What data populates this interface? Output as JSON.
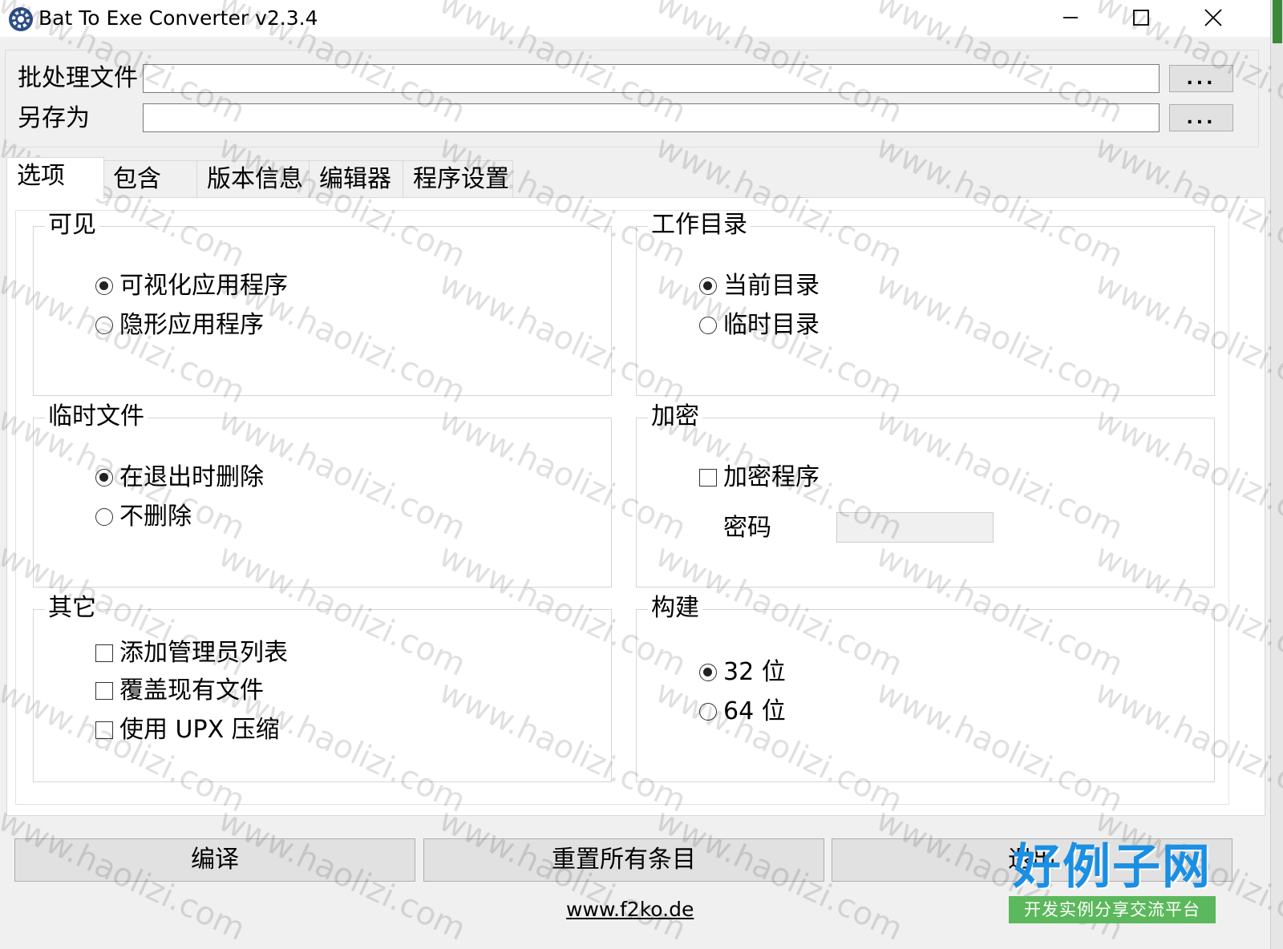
{
  "window": {
    "title": "Bat To Exe Converter v2.3.4",
    "controls": {
      "minimize": "─",
      "maximize": "☐",
      "close": "✕"
    }
  },
  "files": {
    "batch_label": "批处理文件",
    "batch_value": "",
    "saveas_label": "另存为",
    "saveas_value": "",
    "browse_label": "..."
  },
  "tabs": [
    {
      "label": "选项",
      "active": true
    },
    {
      "label": "包含",
      "active": false
    },
    {
      "label": "版本信息",
      "active": false
    },
    {
      "label": "编辑器",
      "active": false
    },
    {
      "label": "程序设置",
      "active": false
    }
  ],
  "options": {
    "visible": {
      "title": "可见",
      "items": [
        {
          "label": "可视化应用程序",
          "selected": true
        },
        {
          "label": "隐形应用程序",
          "selected": false
        }
      ]
    },
    "workdir": {
      "title": "工作目录",
      "items": [
        {
          "label": "当前目录",
          "selected": true
        },
        {
          "label": "临时目录",
          "selected": false
        }
      ]
    },
    "tempfiles": {
      "title": "临时文件",
      "items": [
        {
          "label": "在退出时删除",
          "selected": true
        },
        {
          "label": "不删除",
          "selected": false
        }
      ]
    },
    "encryption": {
      "title": "加密",
      "encrypt_label": "加密程序",
      "encrypt_checked": false,
      "password_label": "密码",
      "password_value": ""
    },
    "other": {
      "title": "其它",
      "items": [
        {
          "label": "添加管理员列表",
          "checked": false
        },
        {
          "label": "覆盖现有文件",
          "checked": false
        },
        {
          "label": "使用 UPX 压缩",
          "checked": false
        }
      ]
    },
    "build": {
      "title": "构建",
      "items": [
        {
          "label": "32 位",
          "selected": true
        },
        {
          "label": "64 位",
          "selected": false
        }
      ]
    }
  },
  "buttons": {
    "compile": "编译",
    "reset": "重置所有条目",
    "exit": "退出"
  },
  "footer": {
    "link": "www.f2ko.de"
  },
  "watermark": {
    "text": "www.haolizi.com",
    "badge_title": "好例子网",
    "badge_subtitle": "开发实例分享交流平台"
  },
  "colors": {
    "window_bg": "#f0f0f0",
    "panel_bg": "#ffffff",
    "badge_blue": "#1a8fe3",
    "badge_green": "#5cb85c"
  }
}
